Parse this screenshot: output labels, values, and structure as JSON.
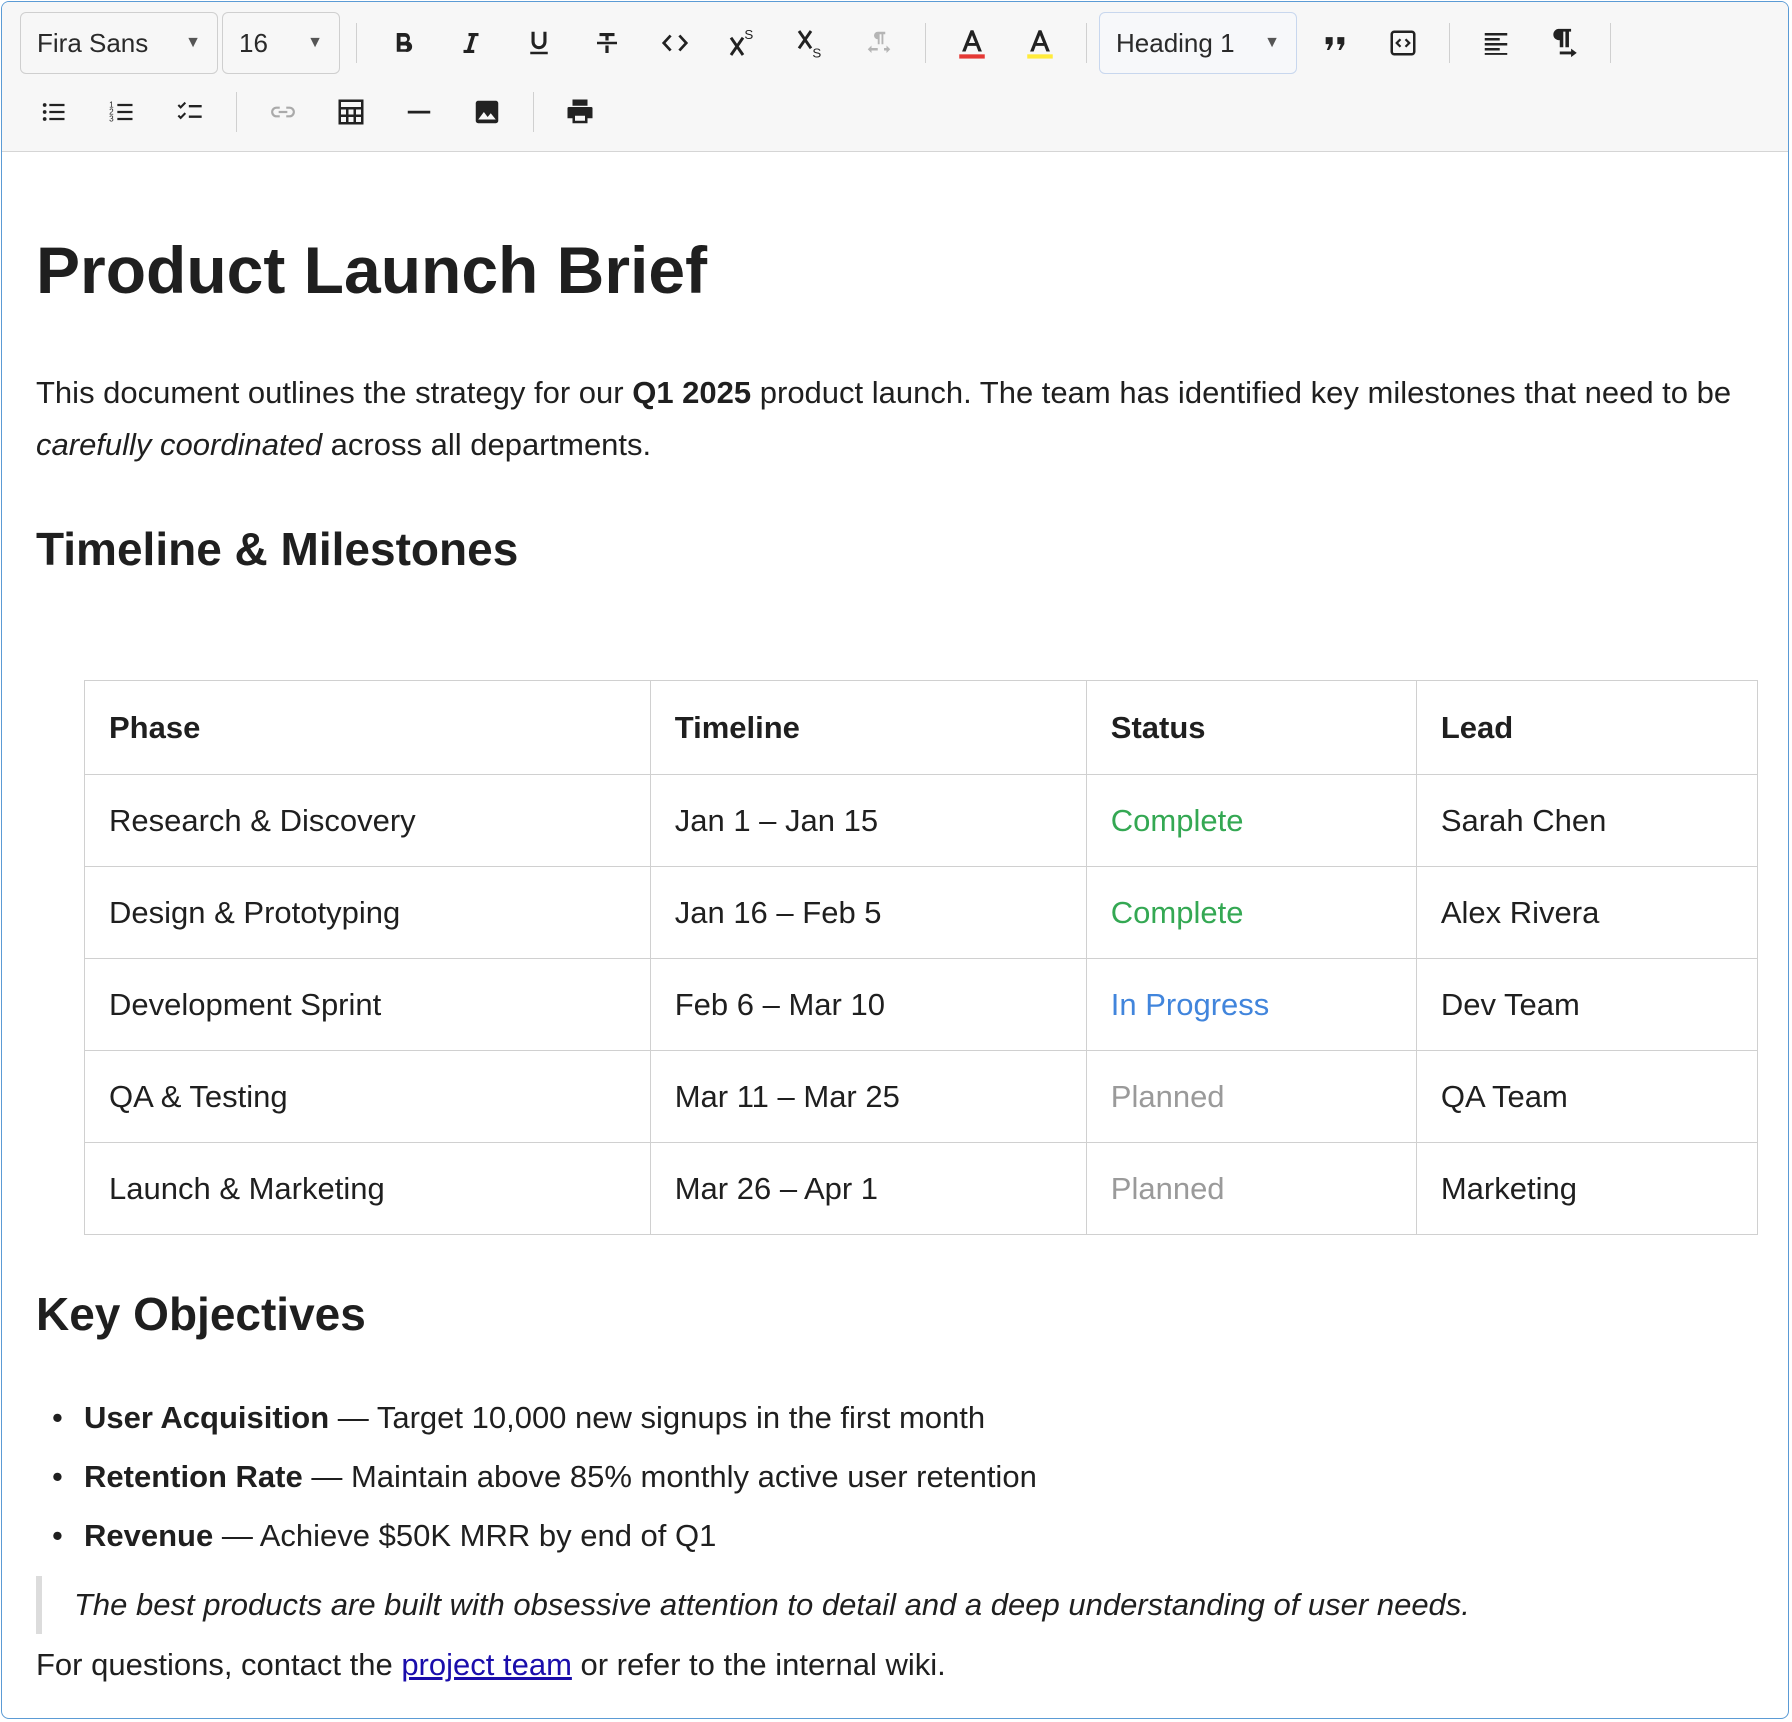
{
  "toolbar": {
    "font_family": "Fira Sans",
    "font_size": "16",
    "block_style": "Heading 1",
    "colors": {
      "text_color_underline": "#e53935",
      "highlight_underline": "#ffeb3b"
    }
  },
  "document": {
    "title": "Product Launch Brief",
    "intro": {
      "part1": "This document outlines the strategy for our ",
      "bold": "Q1 2025",
      "part2": " product launch. The team has identified key milestones that need to be ",
      "italic": "carefully coordinated",
      "part3": " across all departments."
    },
    "timeline_heading": "Timeline & Milestones",
    "table": {
      "headers": [
        "Phase",
        "Timeline",
        "Status",
        "Lead"
      ],
      "rows": [
        [
          "Research & Discovery",
          "Jan 1 – Jan 15",
          "Complete",
          "Sarah Chen"
        ],
        [
          "Design & Prototyping",
          "Jan 16 – Feb 5",
          "Complete",
          "Alex Rivera"
        ],
        [
          "Development Sprint",
          "Feb 6 – Mar 10",
          "In Progress",
          "Dev Team"
        ],
        [
          "QA & Testing",
          "Mar 11 – Mar 25",
          "Planned",
          "QA Team"
        ],
        [
          "Launch & Marketing",
          "Mar 26 – Apr 1",
          "Planned",
          "Marketing"
        ]
      ]
    },
    "status_colors": {
      "Complete": "#34a853",
      "In Progress": "#4185dc",
      "Planned": "#9a9a9a"
    },
    "objectives_heading": "Key Objectives",
    "objectives": [
      {
        "label": "User Acquisition",
        "text": " — Target 10,000 new signups in the first month"
      },
      {
        "label": "Retention Rate",
        "text": " — Maintain above 85% monthly active user retention"
      },
      {
        "label": "Revenue",
        "text": " — Achieve $50K MRR by end of Q1"
      }
    ],
    "quote": "The best products are built with obsessive attention to detail and a deep understanding of user needs.",
    "footer": {
      "before": "For questions, contact the ",
      "link": "project team",
      "after": " or refer to the internal wiki."
    }
  }
}
